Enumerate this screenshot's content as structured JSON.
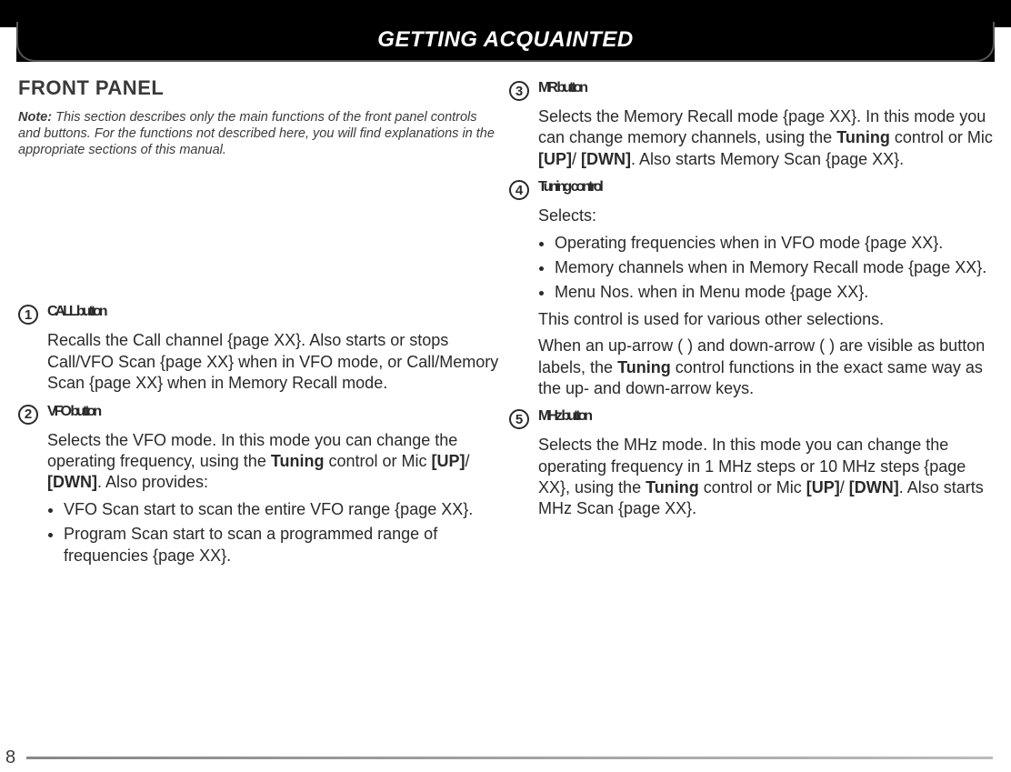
{
  "header": {
    "title": "GETTING ACQUAINTED"
  },
  "section": {
    "title": "FRONT PANEL",
    "note_label": "Note:",
    "note_text": "  This section describes only the main functions of the front panel controls and buttons.  For the functions not described here, you will find explanations in the appropriate sections of this manual."
  },
  "items": {
    "1": {
      "num": "1",
      "head": "CALL button",
      "p1_a": "Recalls the Call channel {page XX}.  Also starts or stops Call/VFO Scan {page XX} when in VFO mode, or Call/Memory Scan {page XX} when in Memory Recall mode."
    },
    "2": {
      "num": "2",
      "head": "VFO button",
      "p1_a": "Selects the VFO mode.  In this mode you can change the operating frequency, using the ",
      "p1_b": "Tuning",
      "p1_c": " control or Mic ",
      "p1_d": "[UP]",
      "p1_e": "/ ",
      "p1_f": "[DWN]",
      "p1_g": ".  Also provides:",
      "b1": "VFO Scan start to scan the entire VFO range {page XX}.",
      "b2": "Program Scan start to scan a programmed range of frequencies {page XX}."
    },
    "3": {
      "num": "3",
      "head": "MR button",
      "p1_a": "Selects the Memory Recall mode {page XX}.  In this mode you can change memory channels, using the ",
      "p1_b": "Tuning",
      "p1_c": " control or Mic ",
      "p1_d": "[UP]",
      "p1_e": "/ ",
      "p1_f": "[DWN]",
      "p1_g": ".  Also starts Memory Scan {page XX}."
    },
    "4": {
      "num": "4",
      "head": "Tuning control",
      "p1": "Selects:",
      "b1": "Operating frequencies when in VFO mode {page XX}.",
      "b2": "Memory channels when in Memory Recall mode {page XX}.",
      "b3": "Menu Nos. when in Menu mode {page XX}.",
      "p2": "This control is used for various other selections.",
      "p3_a": "When an up-arrow ( ) and down-arrow ( ) are visible as button labels, the ",
      "p3_b": "Tuning",
      "p3_c": " control functions in the exact same way as the up- and down-arrow keys."
    },
    "5": {
      "num": "5",
      "head": "MHz button",
      "p1_a": "Selects the MHz mode.  In this mode you can change the operating frequency in 1 MHz steps or 10 MHz steps {page XX}, using the ",
      "p1_b": "Tuning",
      "p1_c": " control or Mic ",
      "p1_d": "[UP]",
      "p1_e": "/ ",
      "p1_f": "[DWN]",
      "p1_g": ".  Also starts MHz Scan {page XX}."
    }
  },
  "footer": {
    "page": "8"
  }
}
